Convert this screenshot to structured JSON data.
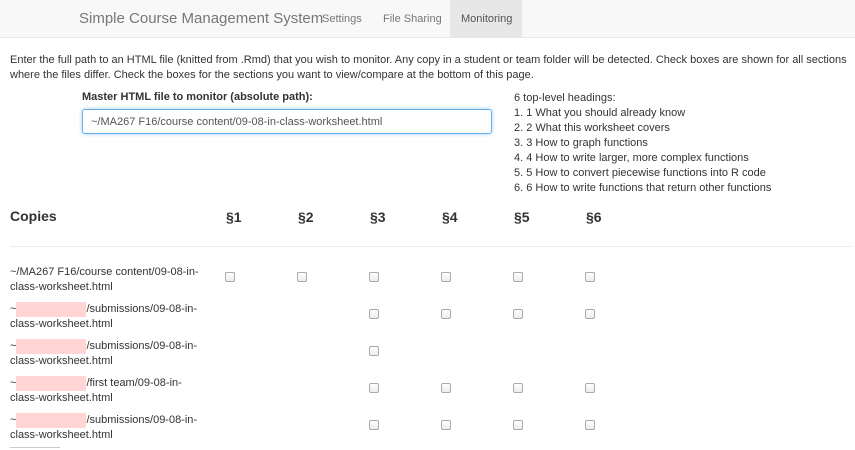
{
  "navbar": {
    "brand": "Simple Course Management System",
    "tabs": [
      {
        "label": "Settings",
        "active": false
      },
      {
        "label": "File Sharing",
        "active": false
      },
      {
        "label": "Monitoring",
        "active": true
      }
    ]
  },
  "intro": "Enter the full path to an HTML file (knitted from .Rmd) that you wish to monitor. Any copy in a student or team folder will be detected. Check boxes are shown for all sections where the files differ. Check the boxes for the sections you want to view/compare at the bottom of this page.",
  "master": {
    "label": "Master HTML file to monitor (absolute path):",
    "value": "~/MA267 F16/course content/09-08-in-class-worksheet.html"
  },
  "headings": {
    "title": "6 top-level headings:",
    "items": [
      "1. 1 What you should already know",
      "2. 2 What this worksheet covers",
      "3. 3 How to graph functions",
      "4. 4 How to write larger, more complex functions",
      "5. 5 How to convert piecewise functions into R code",
      "6. 6 How to write functions that return other functions"
    ]
  },
  "copies": {
    "title": "Copies",
    "sections": [
      "§1",
      "§2",
      "§3",
      "§4",
      "§5",
      "§6"
    ],
    "rows": [
      {
        "line1_pre": "~/MA267 F16/course content/09-08-in-",
        "redacted": false,
        "line1_post": "",
        "line2": "class-worksheet.html",
        "checkboxes": [
          true,
          true,
          true,
          true,
          true,
          true
        ]
      },
      {
        "line1_pre": "~",
        "redacted": true,
        "line1_post": "/submissions/09-08-in-",
        "line2": "class-worksheet.html",
        "checkboxes": [
          false,
          false,
          true,
          true,
          true,
          true
        ]
      },
      {
        "line1_pre": "~",
        "redacted": true,
        "line1_post": "/submissions/09-08-in-",
        "line2": "class-worksheet.html",
        "checkboxes": [
          false,
          false,
          true,
          false,
          false,
          false
        ]
      },
      {
        "line1_pre": "~",
        "redacted": true,
        "line1_post": "/first team/09-08-in-",
        "line2": "class-worksheet.html",
        "checkboxes": [
          false,
          false,
          true,
          true,
          true,
          true
        ]
      },
      {
        "line1_pre": "~",
        "redacted": true,
        "line1_post": "/submissions/09-08-in-",
        "line2": "class-worksheet.html",
        "checkboxes": [
          false,
          false,
          true,
          true,
          true,
          true
        ]
      }
    ]
  }
}
